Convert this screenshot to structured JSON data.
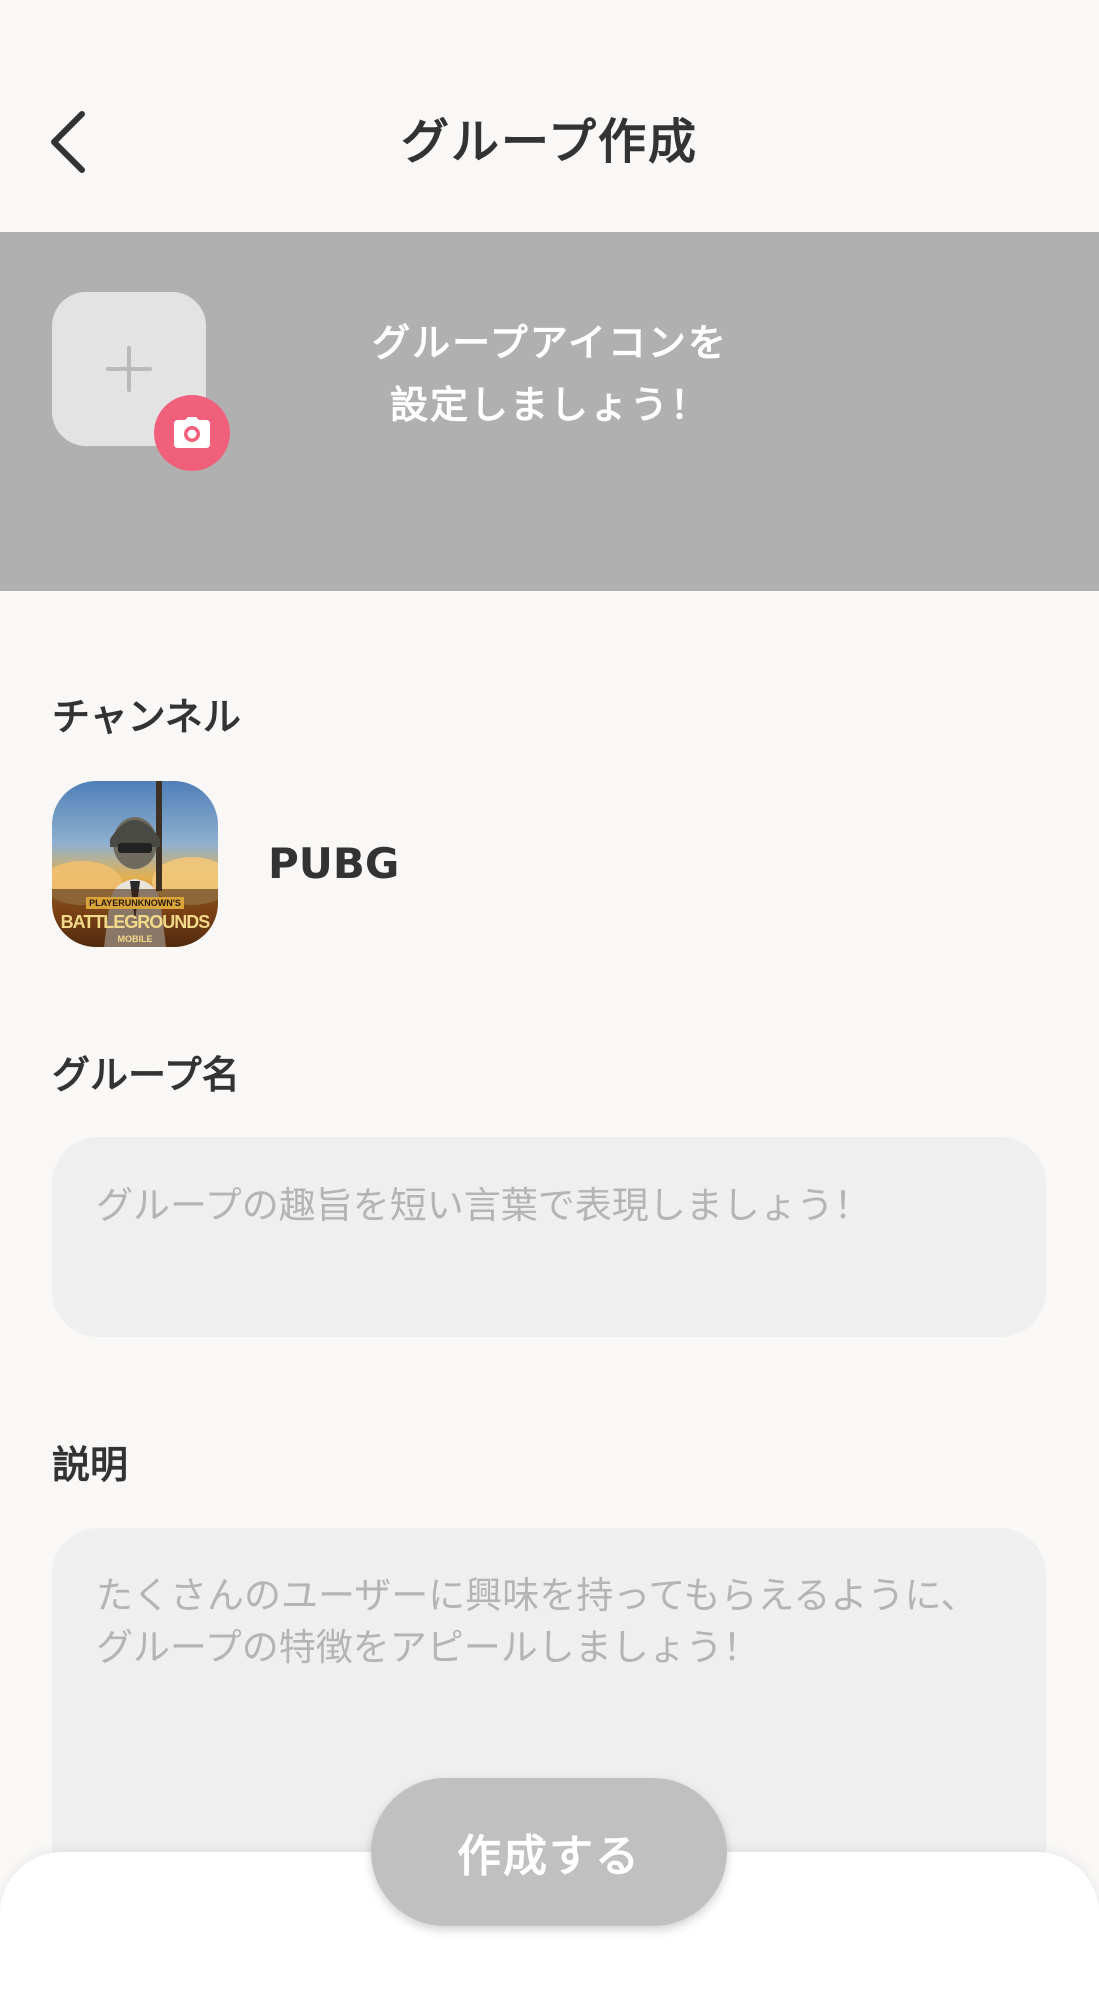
{
  "header": {
    "title": "グループ作成",
    "back_icon": "chevron-left-icon"
  },
  "group_icon": {
    "prompt_line1": "グループアイコンを",
    "prompt_line2": "設定しましょう！",
    "add_icon": "plus-icon",
    "camera_icon": "camera-icon",
    "camera_badge_color": "#f0607b"
  },
  "channel": {
    "label": "チャンネル",
    "name": "PUBG",
    "thumbnail_logo_line1": "PLAYERUNKNOWN'S",
    "thumbnail_logo_line2": "BATTLEGROUNDS",
    "thumbnail_logo_line3": "MOBILE"
  },
  "group_name": {
    "label": "グループ名",
    "value": "",
    "placeholder": "グループの趣旨を短い言葉で表現しましょう！"
  },
  "description": {
    "label": "説明",
    "value": "",
    "placeholder": "たくさんのユーザーに興味を持ってもらえるように、グループの特徴をアピールしましょう！"
  },
  "footer": {
    "create_label": "作成する"
  }
}
